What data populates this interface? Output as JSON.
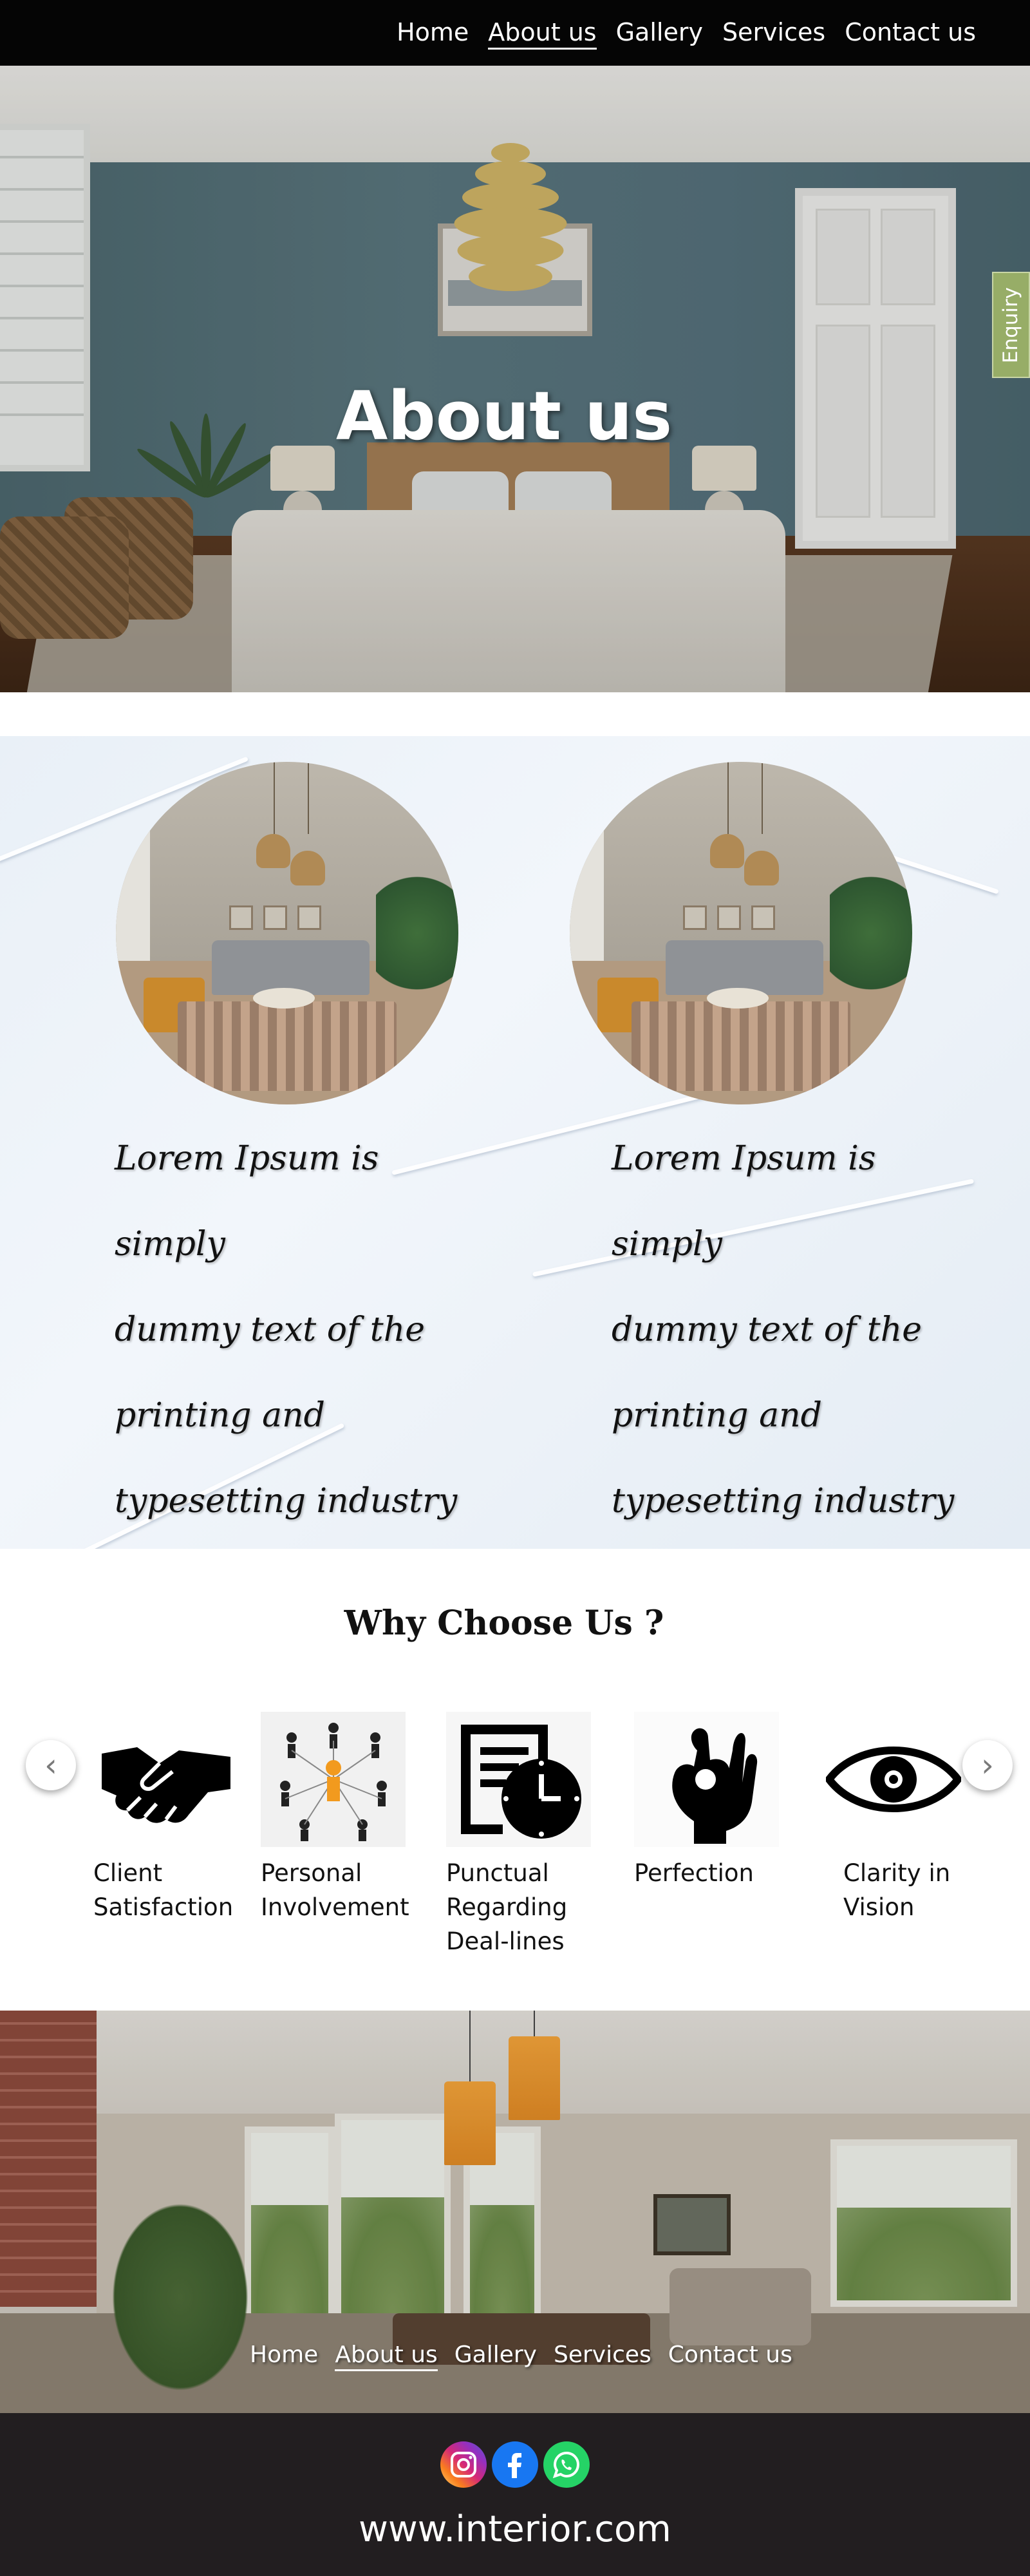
{
  "nav": {
    "items": [
      {
        "label": "Home",
        "active": false
      },
      {
        "label": "About us",
        "active": true
      },
      {
        "label": "Gallery",
        "active": false
      },
      {
        "label": "Services",
        "active": false
      },
      {
        "label": "Contact us",
        "active": false
      }
    ]
  },
  "hero": {
    "title": "About us",
    "enquiry_label": "Enquiry",
    "enquiry_color": "#97ad67"
  },
  "about": {
    "cards": [
      {
        "image": "living-room-photo",
        "text_lines": [
          "Lorem Ipsum is simply",
          "dummy text of the",
          "printing and",
          "typesetting industry"
        ]
      },
      {
        "image": "living-room-photo",
        "text_lines": [
          "Lorem Ipsum is simply",
          "dummy text of the",
          "printing and",
          "typesetting industry"
        ]
      }
    ]
  },
  "why": {
    "title": "Why Choose Us ?",
    "prev_icon": "chevron-left-icon",
    "next_icon": "chevron-right-icon",
    "features": [
      {
        "icon": "handshake-icon",
        "label_lines": [
          "Client",
          "Satisfaction"
        ]
      },
      {
        "icon": "people-network-icon",
        "label_lines": [
          "Personal",
          "Involvement"
        ]
      },
      {
        "icon": "clock-document-icon",
        "label_lines": [
          "Punctual",
          "Regarding",
          "Deal-lines"
        ]
      },
      {
        "icon": "ok-hand-icon",
        "label_lines": [
          "Perfection"
        ]
      },
      {
        "icon": "eye-icon",
        "label_lines": [
          "Clarity in",
          "Vision"
        ]
      }
    ]
  },
  "footer_nav": {
    "items": [
      {
        "label": "Home",
        "active": false
      },
      {
        "label": "About us",
        "active": true
      },
      {
        "label": "Gallery",
        "active": false
      },
      {
        "label": "Services",
        "active": false
      },
      {
        "label": "Contact us",
        "active": false
      }
    ]
  },
  "footer": {
    "social": [
      {
        "icon": "instagram-icon",
        "color": "#c13584"
      },
      {
        "icon": "facebook-icon",
        "color": "#1877f2"
      },
      {
        "icon": "whatsapp-icon",
        "color": "#25d366"
      }
    ],
    "site": "www.interior.com"
  }
}
